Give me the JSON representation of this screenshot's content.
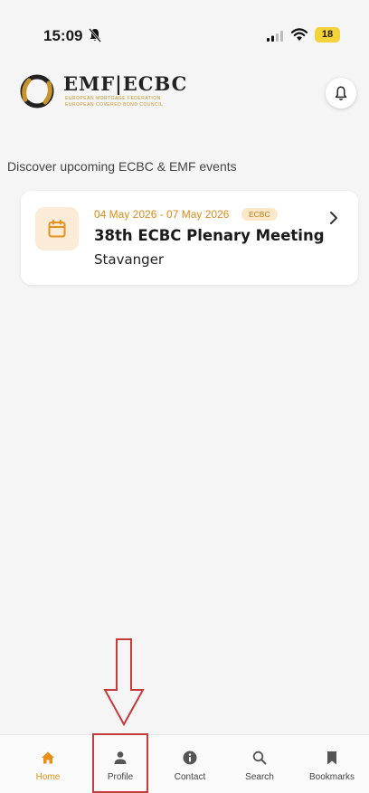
{
  "status_bar": {
    "time": "15:09",
    "battery": "18",
    "battery_color": "#f4d23a"
  },
  "header": {
    "logo_title": "EMF|ECBC",
    "logo_sub1": "EUROPEAN MORTGAGE FEDERATION",
    "logo_sub2": "EUROPEAN COVERED BOND COUNCIL",
    "logo_accent": "#c8932c",
    "icons": [
      "bell-off-icon",
      "signal-icon",
      "wifi-icon",
      "notification-bell-icon"
    ]
  },
  "intro_text": "Discover upcoming ECBC & EMF events",
  "events": [
    {
      "dates": "04 May 2026 - 07 May 2026",
      "tag": "ECBC",
      "title": "38th ECBC Plenary Meeting",
      "place": "Stavanger",
      "icon": "calendar-icon"
    }
  ],
  "colors": {
    "accent": "#e8901a",
    "annotation": "#c63a3a"
  },
  "bottom_nav": {
    "items": [
      {
        "label": "Home",
        "icon": "home-icon",
        "active": true
      },
      {
        "label": "Profile",
        "icon": "user-icon",
        "active": false
      },
      {
        "label": "Contact",
        "icon": "info-icon",
        "active": false
      },
      {
        "label": "Search",
        "icon": "search-icon",
        "active": false
      },
      {
        "label": "Bookmarks",
        "icon": "bookmark-icon",
        "active": false
      }
    ]
  }
}
